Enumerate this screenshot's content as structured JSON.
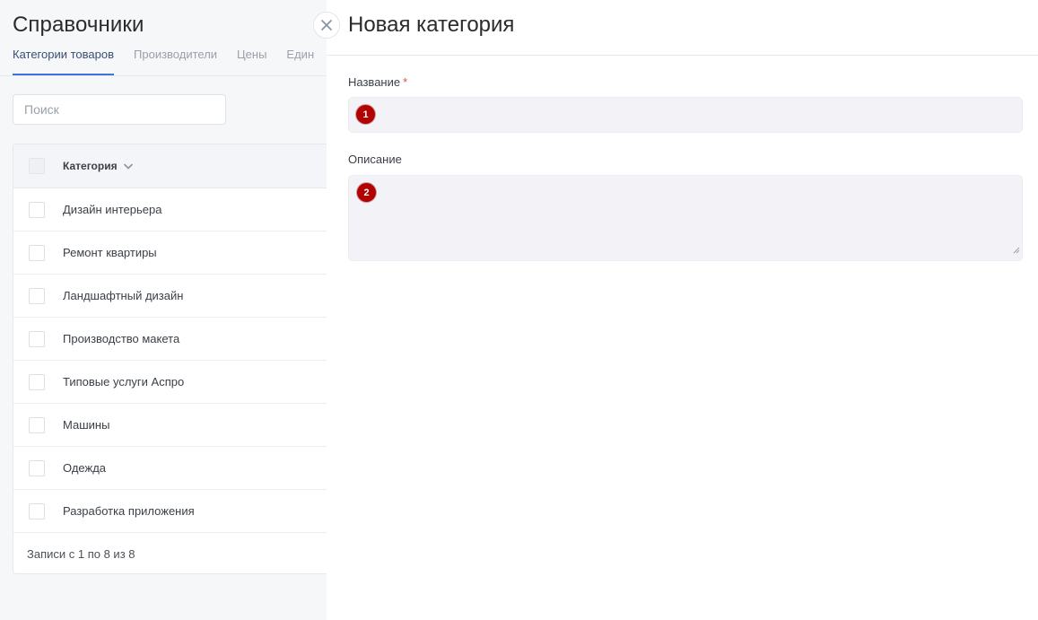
{
  "page": {
    "title": "Справочники",
    "tabs": [
      {
        "label": "Категории товаров",
        "active": true
      },
      {
        "label": "Производители",
        "active": false
      },
      {
        "label": "Цены",
        "active": false
      },
      {
        "label": "Един",
        "active": false
      }
    ],
    "search": {
      "placeholder": "Поиск",
      "value": ""
    }
  },
  "table": {
    "header": {
      "column": "Категория",
      "sort_icon": "chevron-down-icon"
    },
    "rows": [
      "Дизайн интерьера",
      "Ремонт квартиры",
      "Ландшафтный дизайн",
      "Производство макета",
      "Типовые услуги Аспро",
      "Машины",
      "Одежда",
      "Разработка приложения"
    ],
    "footer": "Записи с 1 по 8 из 8"
  },
  "panel": {
    "title": "Новая категория",
    "close_icon": "close-icon",
    "fields": {
      "name": {
        "label": "Название",
        "required_mark": "*",
        "value": "",
        "marker": "1"
      },
      "description": {
        "label": "Описание",
        "value": "",
        "marker": "2"
      }
    }
  },
  "colors": {
    "accent": "#3f73d8",
    "marker": "#b30000",
    "input_bg": "#f2f2f7",
    "required": "#e05252"
  }
}
